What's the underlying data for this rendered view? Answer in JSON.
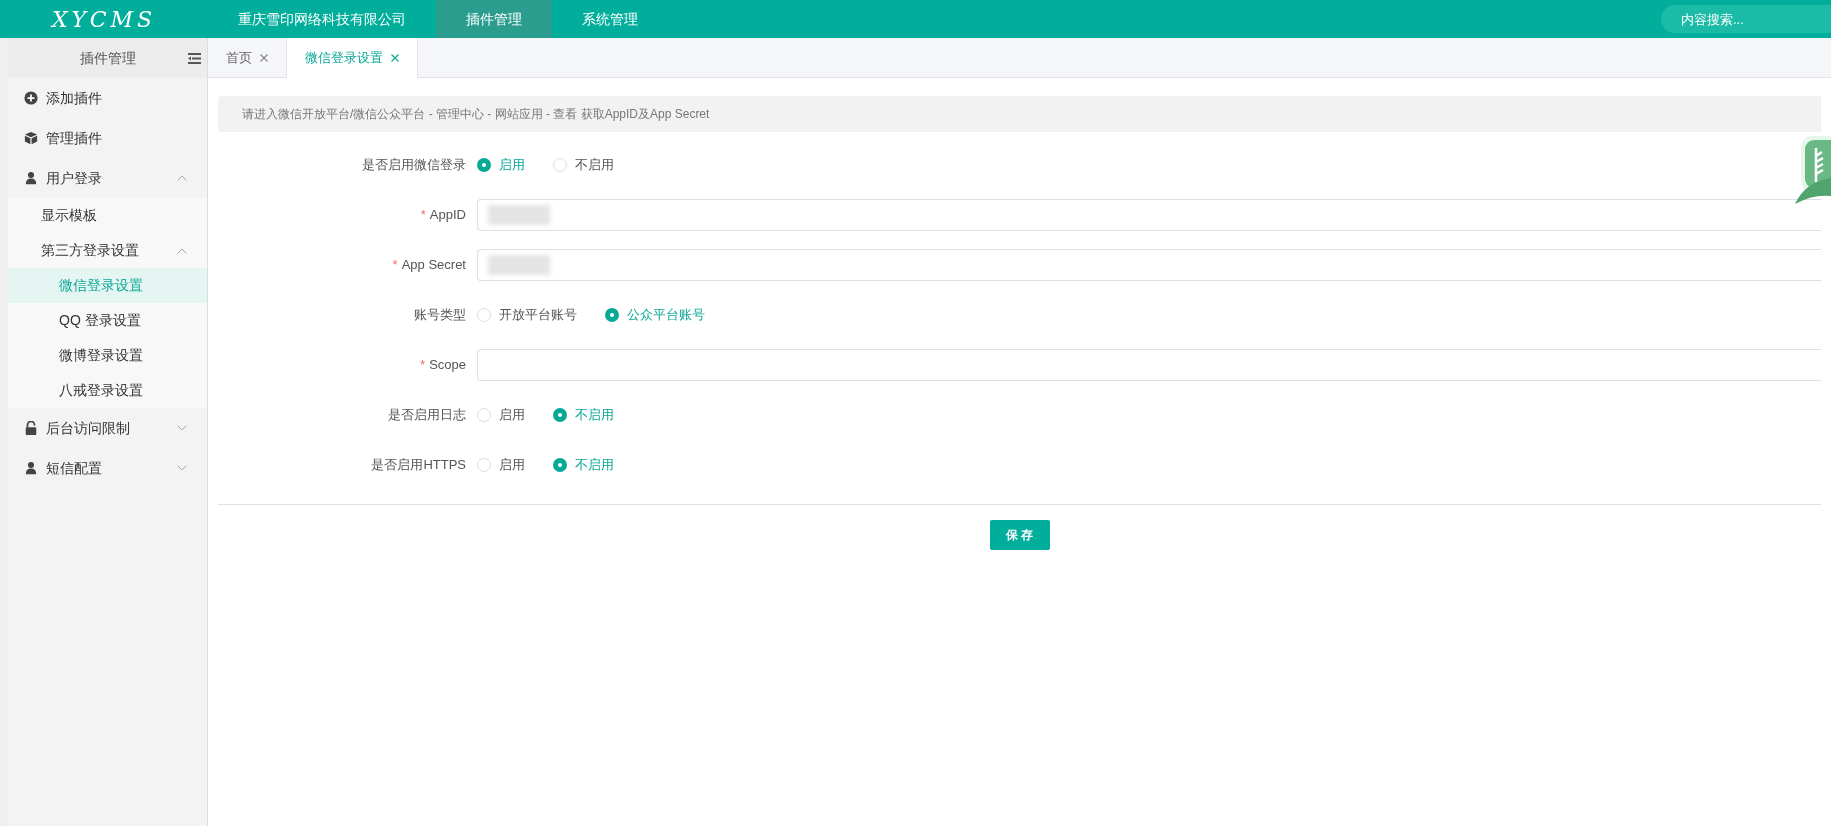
{
  "brand": {
    "logo": "XYCMS"
  },
  "top_nav": [
    {
      "label": "重庆雪印网络科技有限公司",
      "selected": false
    },
    {
      "label": "插件管理",
      "selected": true
    },
    {
      "label": "系统管理",
      "selected": false
    }
  ],
  "search": {
    "placeholder": "内容搜索..."
  },
  "sidebar": {
    "title": "插件管理",
    "items": [
      {
        "kind": "link",
        "label": "添加插件",
        "selected": false
      },
      {
        "kind": "link",
        "label": "管理插件",
        "selected": false
      },
      {
        "kind": "group",
        "label": "用户登录",
        "expanded": true,
        "children": [
          {
            "kind": "link",
            "label": "显示模板",
            "selected": false
          },
          {
            "kind": "group",
            "label": "第三方登录设置",
            "expanded": true,
            "children": [
              {
                "kind": "link",
                "label": "微信登录设置",
                "selected": true
              },
              {
                "kind": "link",
                "label": "QQ 登录设置",
                "selected": false
              },
              {
                "kind": "link",
                "label": "微博登录设置",
                "selected": false
              },
              {
                "kind": "link",
                "label": "八戒登录设置",
                "selected": false
              }
            ]
          }
        ]
      },
      {
        "kind": "group",
        "label": "后台访问限制",
        "expanded": false
      },
      {
        "kind": "group",
        "label": "短信配置",
        "expanded": false
      }
    ]
  },
  "tabs": [
    {
      "label": "首页",
      "selected": false
    },
    {
      "label": "微信登录设置",
      "selected": true
    }
  ],
  "form": {
    "hint": "请进入微信开放平台/微信公众平台 - 管理中心 - 网站应用 - 查看 获取AppID及App Secret",
    "fields": [
      {
        "kind": "radio",
        "label": "是否启用微信登录",
        "options": [
          {
            "label": "启用",
            "selected": true
          },
          {
            "label": "不启用",
            "selected": false
          }
        ]
      },
      {
        "kind": "input",
        "label": "AppID",
        "required_mark": "*",
        "redacted": true
      },
      {
        "kind": "input",
        "label": "App Secret",
        "required_mark": "*",
        "redacted": true
      },
      {
        "kind": "radio",
        "label": "账号类型",
        "options": [
          {
            "label": "开放平台账号",
            "selected": false
          },
          {
            "label": "公众平台账号",
            "selected": true
          }
        ]
      },
      {
        "kind": "input",
        "label": "Scope",
        "required_mark": "*",
        "redacted": false
      },
      {
        "kind": "radio",
        "label": "是否启用日志",
        "options": [
          {
            "label": "启用",
            "selected": false
          },
          {
            "label": "不启用",
            "selected": true
          }
        ]
      },
      {
        "kind": "radio",
        "label": "是否启用HTTPS",
        "options": [
          {
            "label": "启用",
            "selected": false
          },
          {
            "label": "不启用",
            "selected": true
          }
        ]
      }
    ],
    "save_button": "保 存"
  }
}
